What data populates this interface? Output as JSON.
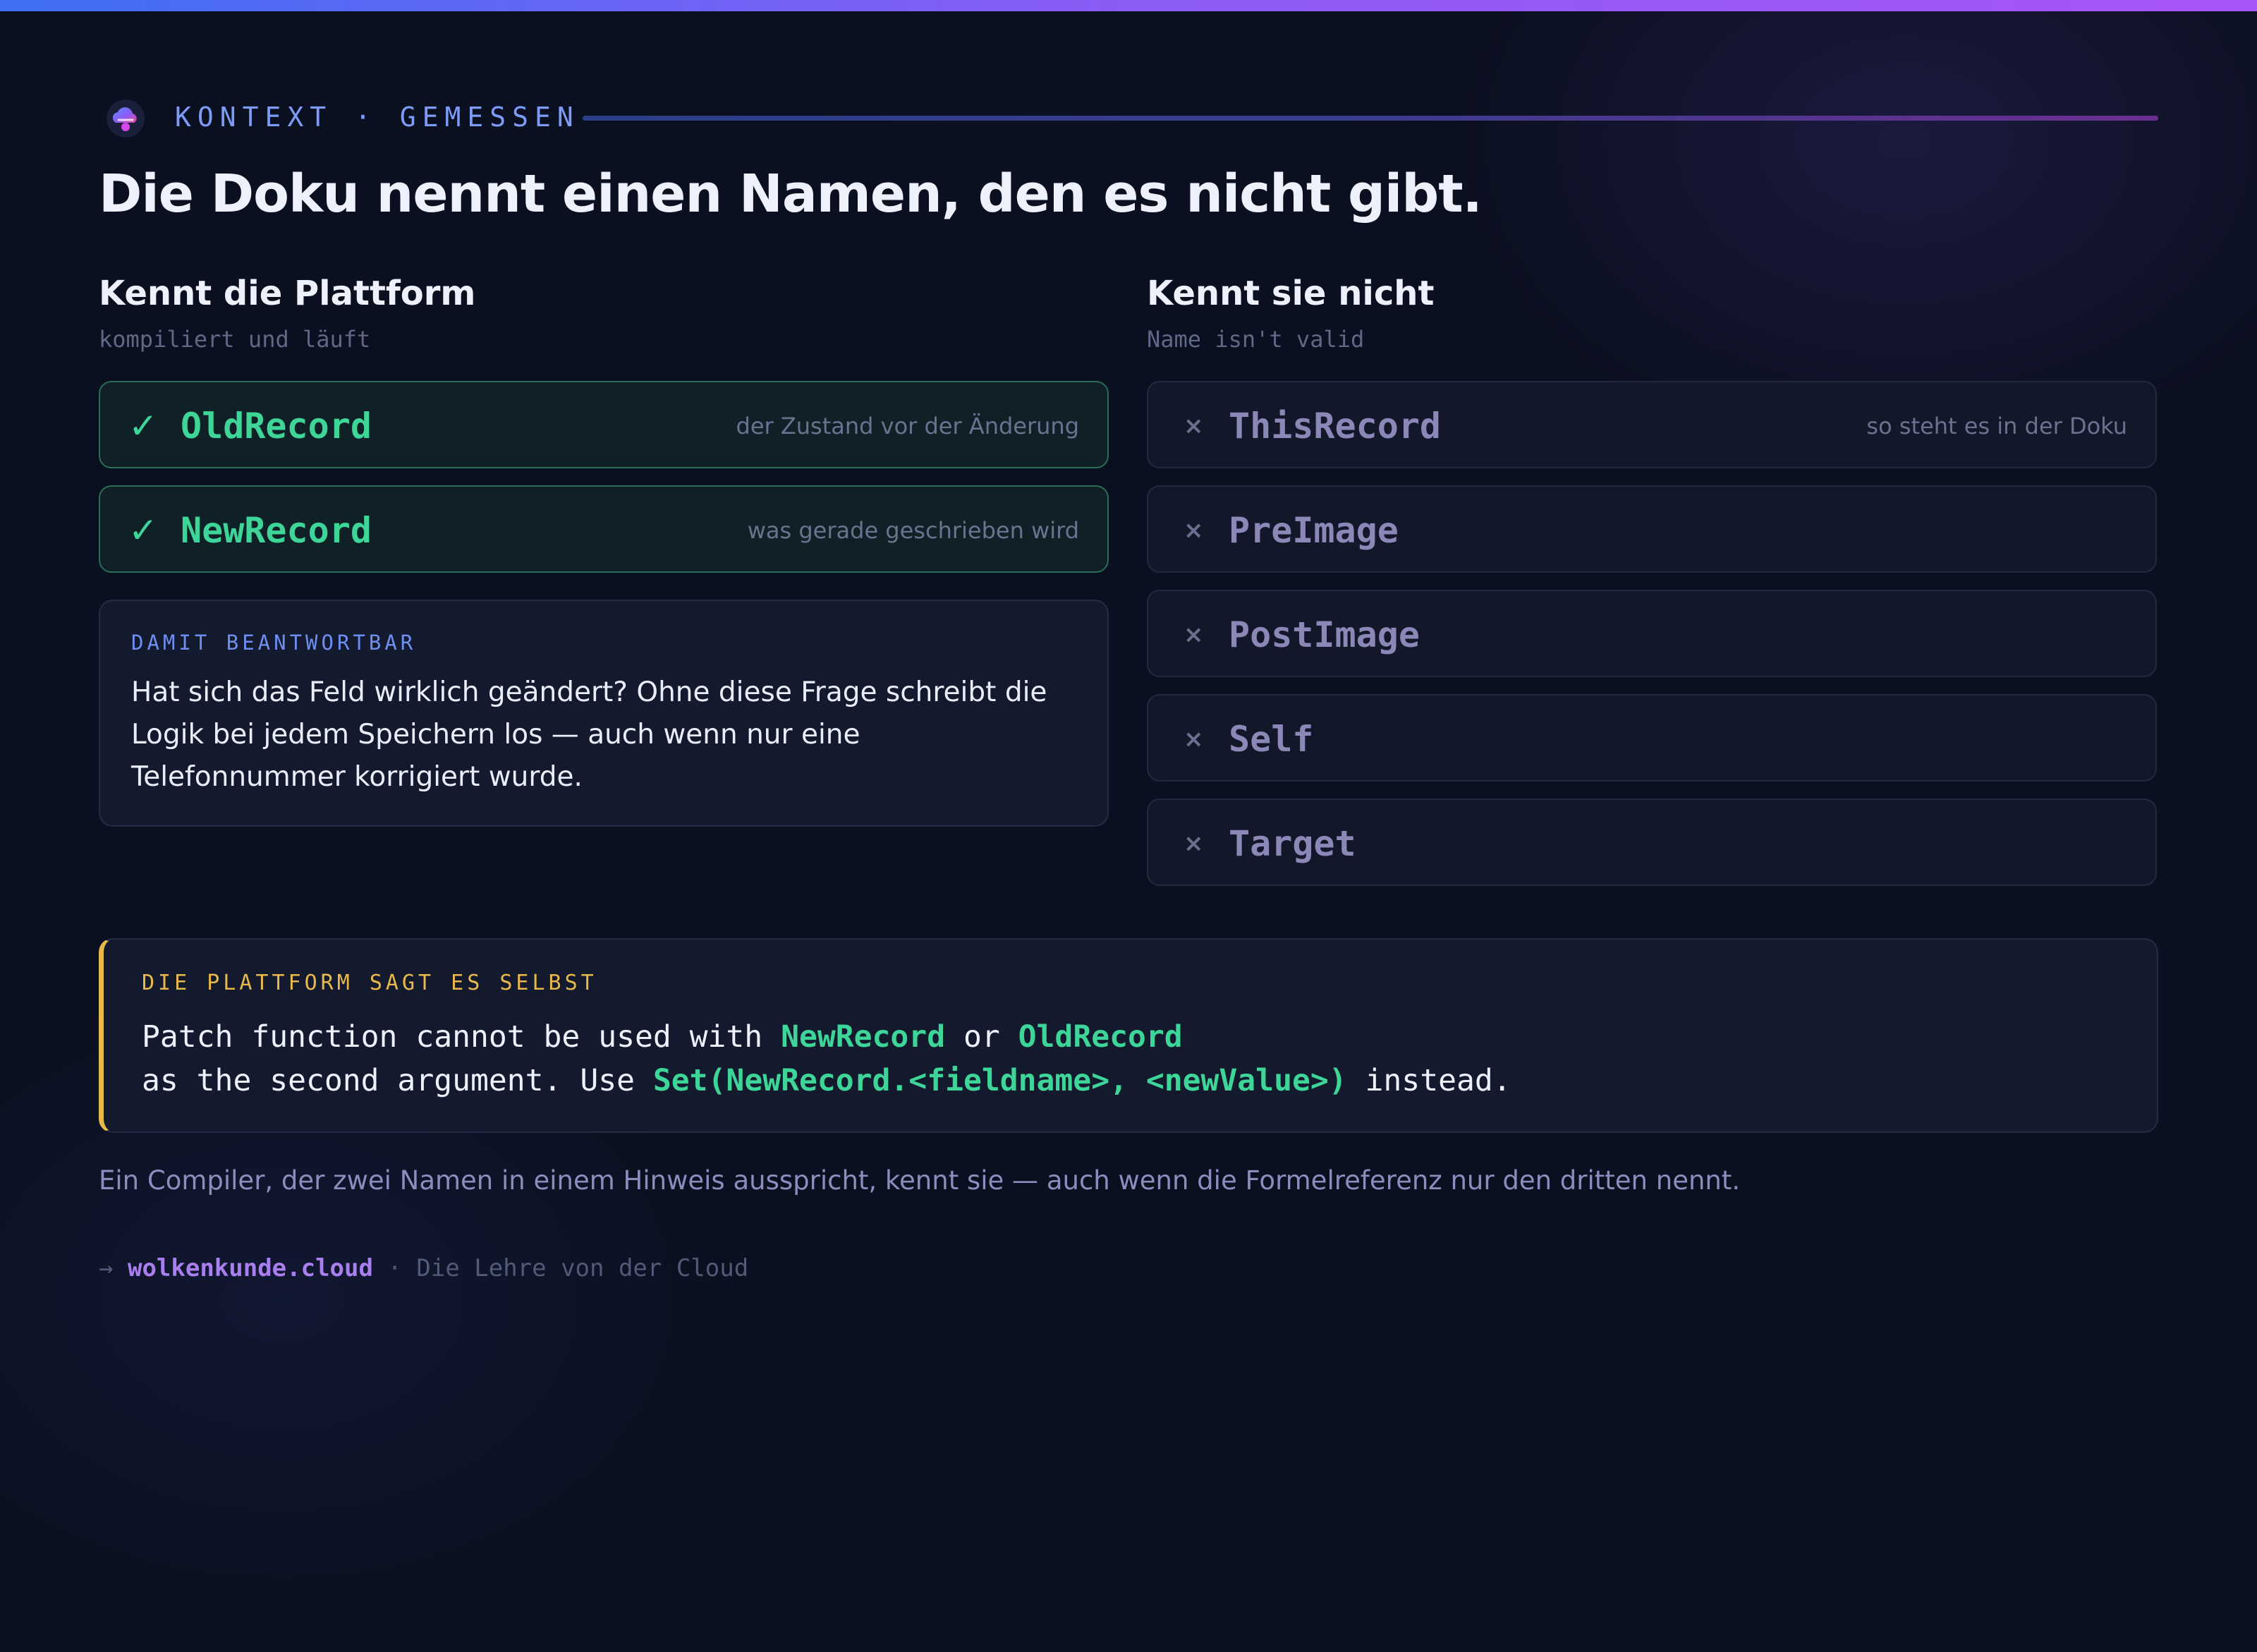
{
  "eyebrow": {
    "text": "KONTEXT · GEMESSEN",
    "logo_icon": "cloud-logo-icon"
  },
  "title": "Die Doku nennt einen Namen, den es nicht gibt.",
  "left": {
    "heading": "Kennt die Plattform",
    "subheading": "kompiliert und läuft",
    "items": [
      {
        "mark": "✓",
        "name": "OldRecord",
        "note": "der Zustand vor der Änderung"
      },
      {
        "mark": "✓",
        "name": "NewRecord",
        "note": "was gerade geschrieben wird"
      }
    ],
    "answer": {
      "label": "DAMIT BEANTWORTBAR",
      "text": "Hat sich das Feld wirklich geändert? Ohne diese Frage schreibt die Logik bei jedem Speichern los — auch wenn nur eine Telefonnummer korrigiert wurde."
    }
  },
  "right": {
    "heading": "Kennt sie nicht",
    "subheading": "Name isn't valid",
    "items": [
      {
        "mark": "×",
        "name": "ThisRecord",
        "note": "so steht es in der Doku"
      },
      {
        "mark": "×",
        "name": "PreImage",
        "note": ""
      },
      {
        "mark": "×",
        "name": "PostImage",
        "note": ""
      },
      {
        "mark": "×",
        "name": "Self",
        "note": ""
      },
      {
        "mark": "×",
        "name": "Target",
        "note": ""
      }
    ]
  },
  "quote": {
    "label": "DIE PLATTFORM SAGT ES SELBST",
    "line1": {
      "a": "Patch function cannot be used with ",
      "b": "NewRecord",
      "c": " or ",
      "d": "OldRecord"
    },
    "line2": {
      "a": "as the second argument. Use ",
      "b": "Set(NewRecord.<fieldname>, <newValue>)",
      "c": " instead."
    }
  },
  "summary": "Ein Compiler, der zwei Namen in einem Hinweis ausspricht, kennt sie — auch wenn die Formelreferenz nur den dritten nennt.",
  "footer": {
    "arrow": "→",
    "site": "wolkenkunde.cloud",
    "tagline": " · Die Lehre von der Cloud"
  },
  "colors": {
    "accent_green": "#3ed598",
    "accent_yellow": "#e9b84a",
    "accent_blue": "#7c9cf7",
    "accent_purple": "#a97ff0"
  }
}
